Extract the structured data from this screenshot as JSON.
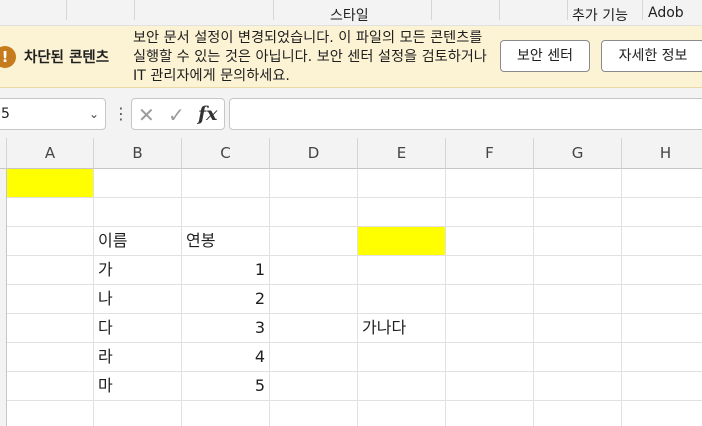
{
  "ribbon": {
    "style_label": "스타일",
    "addins_label": "추가 기능",
    "adobe_label": "Adob"
  },
  "message_bar": {
    "icon": "warning-icon",
    "icon_glyph": "!",
    "title": "차단된 콘텐츠",
    "text": "보안 문서 설정이 변경되었습니다. 이 파일의 모든 콘텐츠를 실행할 수 있는 것은 아닙니다. 보안 센터 설정을 검토하거나 IT 관리자에게 문의하세요.",
    "security_center_button": "보안 센터",
    "details_button": "자세한 정보",
    "background_color": "#fcf3d4"
  },
  "formula_bar": {
    "name_box_value": "5",
    "cancel_icon": "✕",
    "confirm_icon": "✓",
    "function_icon": "fx",
    "formula_value": ""
  },
  "grid": {
    "columns": [
      "A",
      "B",
      "C",
      "D",
      "E",
      "F",
      "G",
      "H"
    ],
    "cells": {
      "B4": "이름",
      "C4": "연봉",
      "B5": "가",
      "C5": "1",
      "B6": "나",
      "C6": "2",
      "B7": "다",
      "C7": "3",
      "E7": "가나다",
      "B8": "라",
      "C8": "4",
      "B9": "마",
      "C9": "5"
    },
    "highlight_color": "#ffff00",
    "highlighted_cells": [
      "A2",
      "E4"
    ]
  }
}
